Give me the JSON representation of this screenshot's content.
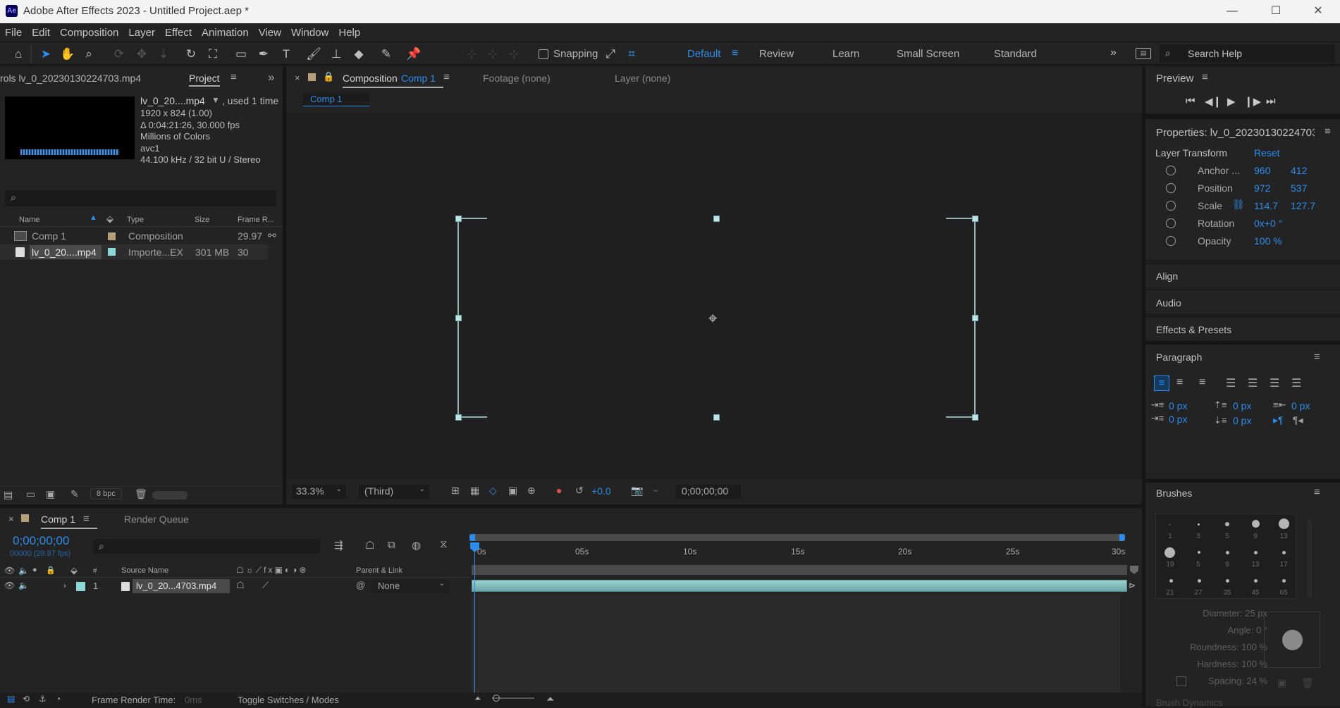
{
  "window": {
    "title": "Adobe After Effects 2023 - Untitled Project.aep *",
    "logo": "Ae",
    "min": "—",
    "max": "☐",
    "close": "✕"
  },
  "menu": [
    "File",
    "Edit",
    "Composition",
    "Layer",
    "Effect",
    "Animation",
    "View",
    "Window",
    "Help"
  ],
  "toolbar": {
    "snapping": "Snapping",
    "workspaces": [
      "Default",
      "Review",
      "Learn",
      "Small Screen",
      "Standard"
    ],
    "search_placeholder": "Search Help"
  },
  "project": {
    "controls_tab": "rols lv_0_20230130224703.mp4",
    "tab": "Project",
    "file_name": "lv_0_20....mp4",
    "used": ", used 1 time",
    "info": [
      "1920 x 824 (1.00)",
      "Δ 0:04:21:26, 30.000 fps",
      "Millions of Colors",
      "avc1",
      "44.100 kHz / 32 bit U / Stereo"
    ],
    "columns": [
      "Name",
      "Type",
      "Size",
      "Frame R..."
    ],
    "items": [
      {
        "name": "Comp 1",
        "type": "Composition",
        "size": "",
        "fps": "29.97",
        "color": "#b5a07a"
      },
      {
        "name": "lv_0_20....mp4",
        "type": "Importe...EX",
        "size": "301 MB",
        "fps": "30",
        "color": "#8fd6d6"
      }
    ],
    "bpc": "8 bpc"
  },
  "viewer": {
    "comp_tab_prefix": "Composition",
    "comp_tab_name": "Comp 1",
    "footage_tab": "Footage (none)",
    "layer_tab": "Layer (none)",
    "breadcrumb": "Comp 1",
    "zoom": "33.3%",
    "resolution": "(Third)",
    "exposure": "+0.0",
    "timecode": "0;00;00;00"
  },
  "right": {
    "preview": "Preview",
    "properties_title": "Properties: lv_0_20230130224703",
    "layer_transform": "Layer Transform",
    "reset": "Reset",
    "props": [
      {
        "label": "Anchor ...",
        "v1": "960",
        "v2": "412"
      },
      {
        "label": "Position",
        "v1": "972",
        "v2": "537"
      },
      {
        "label": "Scale",
        "v1": "114.7",
        "v2": "127.7"
      },
      {
        "label": "Rotation",
        "v1": "0x+0 °",
        "v2": ""
      },
      {
        "label": "Opacity",
        "v1": "100 %",
        "v2": ""
      }
    ],
    "align": "Align",
    "audio": "Audio",
    "effects": "Effects & Presets",
    "paragraph": "Paragraph",
    "para_vals": [
      "0 px",
      "0 px",
      "0 px",
      "0 px",
      "0 px"
    ],
    "brushes": "Brushes",
    "brush_sizes": [
      "1",
      "3",
      "5",
      "9",
      "13",
      "19",
      "5",
      "9",
      "13",
      "17",
      "21",
      "27",
      "35",
      "45",
      "65"
    ],
    "diameter": "Diameter: 25 px",
    "angle": "Angle: 0 °",
    "roundness": "Roundness: 100 %",
    "hardness": "Hardness: 100 %",
    "spacing": "Spacing: 24 %",
    "brush_dynamics": "Brush Dynamics"
  },
  "timeline": {
    "tab": "Comp 1",
    "render_queue": "Render Queue",
    "timecode": "0;00;00;00",
    "fps": "00000 (29.97 fps)",
    "source_name": "Source Name",
    "parent_link": "Parent & Link",
    "hash": "#",
    "ruler": [
      "0s",
      "05s",
      "10s",
      "15s",
      "20s",
      "25s",
      "30s"
    ],
    "layer": {
      "num": "1",
      "name": "lv_0_20...4703.mp4",
      "parent": "None"
    },
    "frame_render": "Frame Render Time:",
    "frame_render_val": "0ms",
    "toggle": "Toggle Switches / Modes"
  }
}
